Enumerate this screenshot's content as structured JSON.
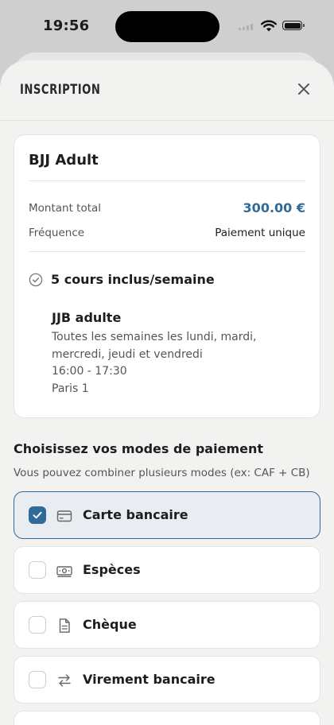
{
  "status_bar": {
    "time": "19:56"
  },
  "header": {
    "title": "INSCRIPTION"
  },
  "plan": {
    "name": "BJJ Adult",
    "total_label": "Montant total",
    "total_value": "300.00 €",
    "frequency_label": "Fréquence",
    "frequency_value": "Paiement unique",
    "courses_included": "5 cours inclus/semaine",
    "class": {
      "title": "JJB adulte",
      "schedule_line1": "Toutes les semaines les lundi, mardi,",
      "schedule_line2": "mercredi, jeudi et vendredi",
      "time": "16:00 - 17:30",
      "location": "Paris 1"
    }
  },
  "payment": {
    "title": "Choisissez vos modes de paiement",
    "subtitle": "Vous pouvez combiner plusieurs modes (ex: CAF + CB)",
    "options": [
      {
        "label": "Carte bancaire",
        "icon": "credit-card-icon",
        "selected": true
      },
      {
        "label": "Espèces",
        "icon": "cash-icon",
        "selected": false
      },
      {
        "label": "Chèque",
        "icon": "document-icon",
        "selected": false
      },
      {
        "label": "Virement bancaire",
        "icon": "transfer-arrows-icon",
        "selected": false
      }
    ]
  },
  "colors": {
    "accent": "#2e6b9a",
    "sheet_bg": "#f2f2f0"
  }
}
